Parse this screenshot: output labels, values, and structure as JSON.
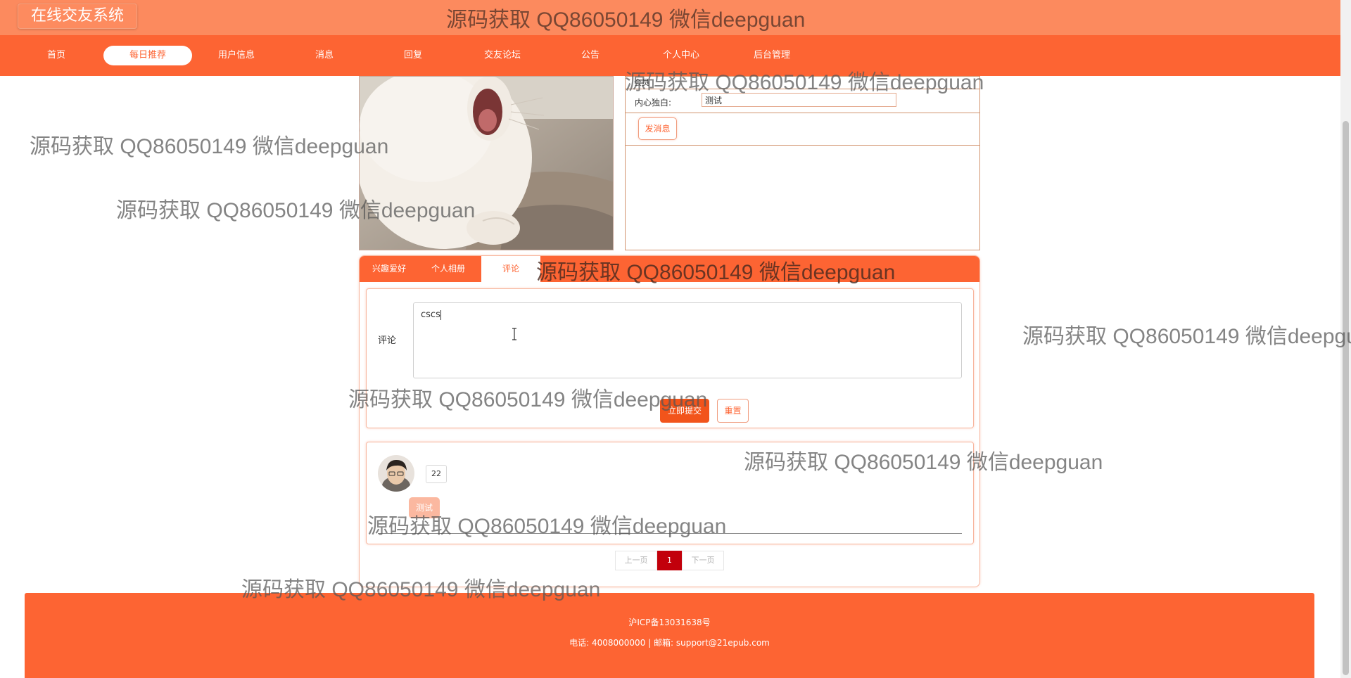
{
  "header": {
    "logo": "在线交友系统"
  },
  "nav": {
    "items": [
      "首页",
      "每日推荐",
      "用户信息",
      "消息",
      "回复",
      "交友论坛",
      "公告",
      "个人中心",
      "后台管理"
    ],
    "active": "每日推荐"
  },
  "message_panel": {
    "top_label": "会员",
    "inner_monologue_label": "内心独白:",
    "inner_monologue_value": "测试",
    "send_button": "发消息"
  },
  "tabs": {
    "items": [
      "兴趣爱好",
      "个人相册",
      "评论"
    ],
    "active": "评论"
  },
  "comment_form": {
    "label": "评论",
    "value": "cscs",
    "submit": "立即提交",
    "reset": "重置"
  },
  "comment_list": [
    {
      "username": "22",
      "content": "测试"
    }
  ],
  "pagination": {
    "prev": "上一页",
    "current": "1",
    "next": "下一页"
  },
  "footer": {
    "icp": "沪ICP备13031638号",
    "contact": "电话: 4008000000 | 邮箱: support@21epub.com"
  },
  "watermark": "源码获取 QQ86050149 微信deepguan",
  "colors": {
    "brand": "#fd6433",
    "header": "#fc8a5e",
    "page_active": "#c2000b"
  }
}
